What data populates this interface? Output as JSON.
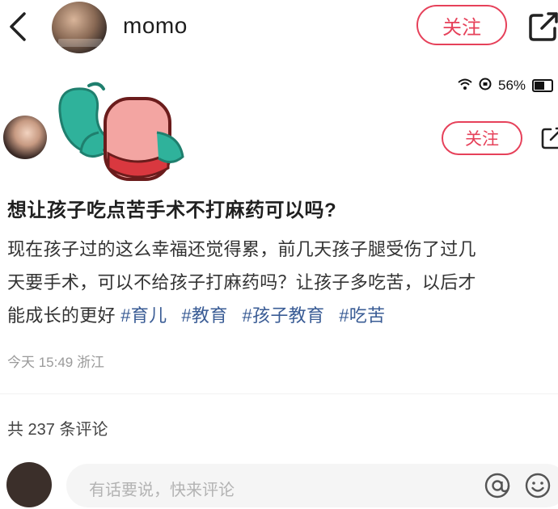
{
  "header": {
    "back_icon": "chevron-left-icon",
    "username": "momo",
    "follow_label": "关注",
    "share_icon": "share-icon"
  },
  "status_bar": {
    "battery": "56%",
    "icons": [
      "wifi-icon",
      "lock-rotation-icon",
      "battery-icon"
    ]
  },
  "inner_post": {
    "follow_label": "关注",
    "share_icon": "share-icon"
  },
  "post": {
    "title": "想让孩子吃点苦手术不打麻药可以吗?",
    "body_lines": [
      "现在孩子过的这么幸福还觉得累，前几天孩子腿受伤了过几",
      "天要手术，可以不给孩子打麻药吗？让孩子多吃苦，以后才",
      "能成长的更好"
    ],
    "hashtags": [
      "#育儿",
      "#教育",
      "#孩子教育",
      "#吃苦"
    ],
    "meta": "今天 15:49 浙江"
  },
  "comments": {
    "count_text": "共 237 条评论",
    "input_placeholder": "有话要说，快来评论"
  },
  "colors": {
    "accent": "#e6415a",
    "hashtag": "#3a5c95"
  }
}
